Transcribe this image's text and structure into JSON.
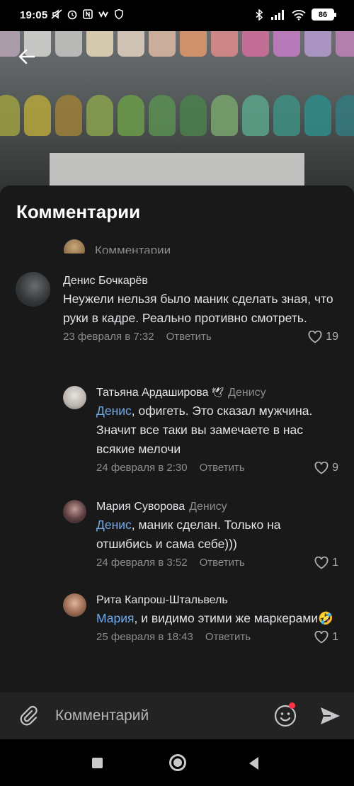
{
  "status_bar": {
    "time": "19:05",
    "battery": "86",
    "left_icons": [
      "muted-icon",
      "alarm-icon",
      "nfc-icon",
      "vk-icon",
      "shield-icon"
    ],
    "right_icons": [
      "bluetooth-icon",
      "signal-icon",
      "wifi-icon",
      "battery-icon"
    ]
  },
  "header": {
    "back_icon": "arrow-left-icon"
  },
  "sheet": {
    "title": "Комментарии",
    "peek_text": "Комментарии"
  },
  "comments": [
    {
      "author": "Денис Бочкарёв",
      "reply_to": "",
      "mention": "",
      "text": "Неужели нельзя было маник сделать зная, что руки в кадре. Реально противно смотреть.",
      "date": "23 февраля в 7:32",
      "reply_label": "Ответить",
      "likes": "19"
    },
    {
      "author": "Татьяна Ардаширова",
      "reply_to": "Денису",
      "mention": "Денис",
      "text": ", офигеть.  Это сказал мужчина. Значит все таки вы замечаете в нас всякие мелочи",
      "date": "24 февраля в 2:30",
      "reply_label": "Ответить",
      "likes": "9"
    },
    {
      "author": "Мария Суворова",
      "reply_to": "Денису",
      "mention": "Денис",
      "text": ", маник сделан. Только на отшибись и сама себе)))",
      "date": "24 февраля в 3:52",
      "reply_label": "Ответить",
      "likes": "1"
    },
    {
      "author": "Рита Капрош-Штальвель",
      "reply_to": "",
      "mention": "Мария",
      "text": ", и видимо этими же маркерами",
      "emoji": "🤣",
      "date": "25 февраля в 18:43",
      "reply_label": "Ответить",
      "likes": "1"
    }
  ],
  "input_bar": {
    "placeholder": "Комментарий"
  },
  "colors": {
    "background": "#19191a",
    "accent_link": "#71aaeb",
    "secondary_text": "#8a8c8f",
    "notification_dot": "#ff3347"
  }
}
